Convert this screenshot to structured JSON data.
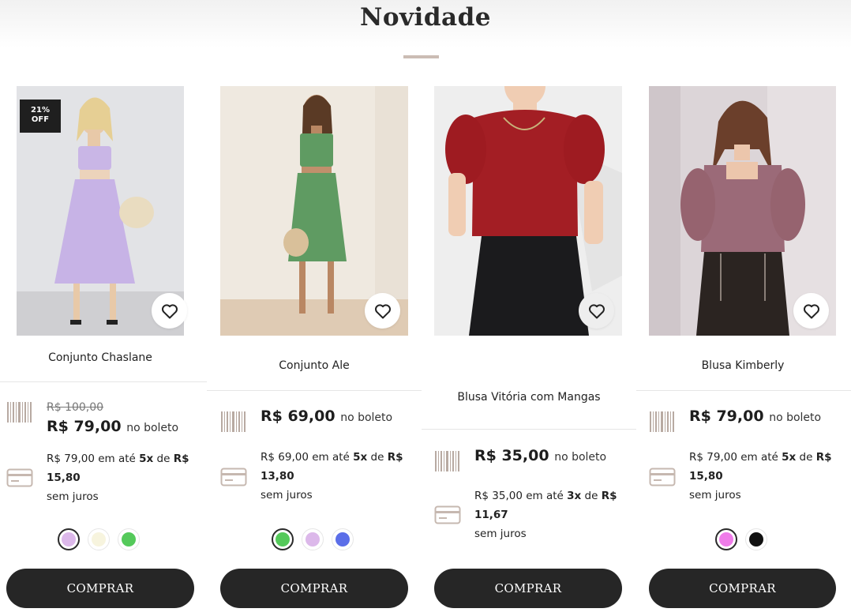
{
  "section": {
    "title": "Novidade"
  },
  "colors": {
    "accent_rule": "#cbbcb4",
    "button_bg": "#262626",
    "badge_bg": "#1f1f1f"
  },
  "products": [
    {
      "name": "Conjunto Chaslane",
      "badge": "21%\nOFF",
      "old_price": "R$ 100,00",
      "price": "R$ 79,00",
      "price_suffix": "no boleto",
      "installment": {
        "prefix": "R$ 79,00 em até ",
        "count": "5x",
        "mid": " de ",
        "currency": "R$",
        "amount": "15,80",
        "tail": "sem juros"
      },
      "swatches": [
        {
          "color": "#dcb8ea",
          "selected": true
        },
        {
          "color": "#f7f4de",
          "selected": false
        },
        {
          "color": "#54c95a",
          "selected": false
        }
      ],
      "button": "COMPRAR",
      "image": "model-lilac-skirt-set"
    },
    {
      "name": "Conjunto Ale",
      "old_price": "",
      "price": "R$ 69,00",
      "price_suffix": "no boleto",
      "installment": {
        "prefix": "R$ 69,00 em até ",
        "count": "5x",
        "mid": " de ",
        "currency": "R$",
        "amount": "13,80",
        "tail": "sem juros"
      },
      "swatches": [
        {
          "color": "#54c95a",
          "selected": true
        },
        {
          "color": "#dcb8ea",
          "selected": false
        },
        {
          "color": "#5b6ee8",
          "selected": false
        }
      ],
      "button": "COMPRAR",
      "image": "model-green-skirt-set"
    },
    {
      "name": "Blusa Vitória com Mangas",
      "old_price": "",
      "price": "R$ 35,00",
      "price_suffix": "no boleto",
      "installment": {
        "prefix": "R$ 35,00 em até ",
        "count": "3x",
        "mid": " de ",
        "currency": "R$",
        "amount": "11,67",
        "tail": "sem juros"
      },
      "swatches": [],
      "button": "COMPRAR",
      "image": "model-red-puff-blouse"
    },
    {
      "name": "Blusa Kimberly",
      "old_price": "",
      "price": "R$ 79,00",
      "price_suffix": "no boleto",
      "installment": {
        "prefix": "R$ 79,00 em até ",
        "count": "5x",
        "mid": " de ",
        "currency": "R$",
        "amount": "15,80",
        "tail": "sem juros"
      },
      "swatches": [
        {
          "color": "#ef7ce9",
          "selected": true
        },
        {
          "color": "#111111",
          "selected": false
        }
      ],
      "button": "COMPRAR",
      "image": "model-mauve-blouse"
    }
  ]
}
